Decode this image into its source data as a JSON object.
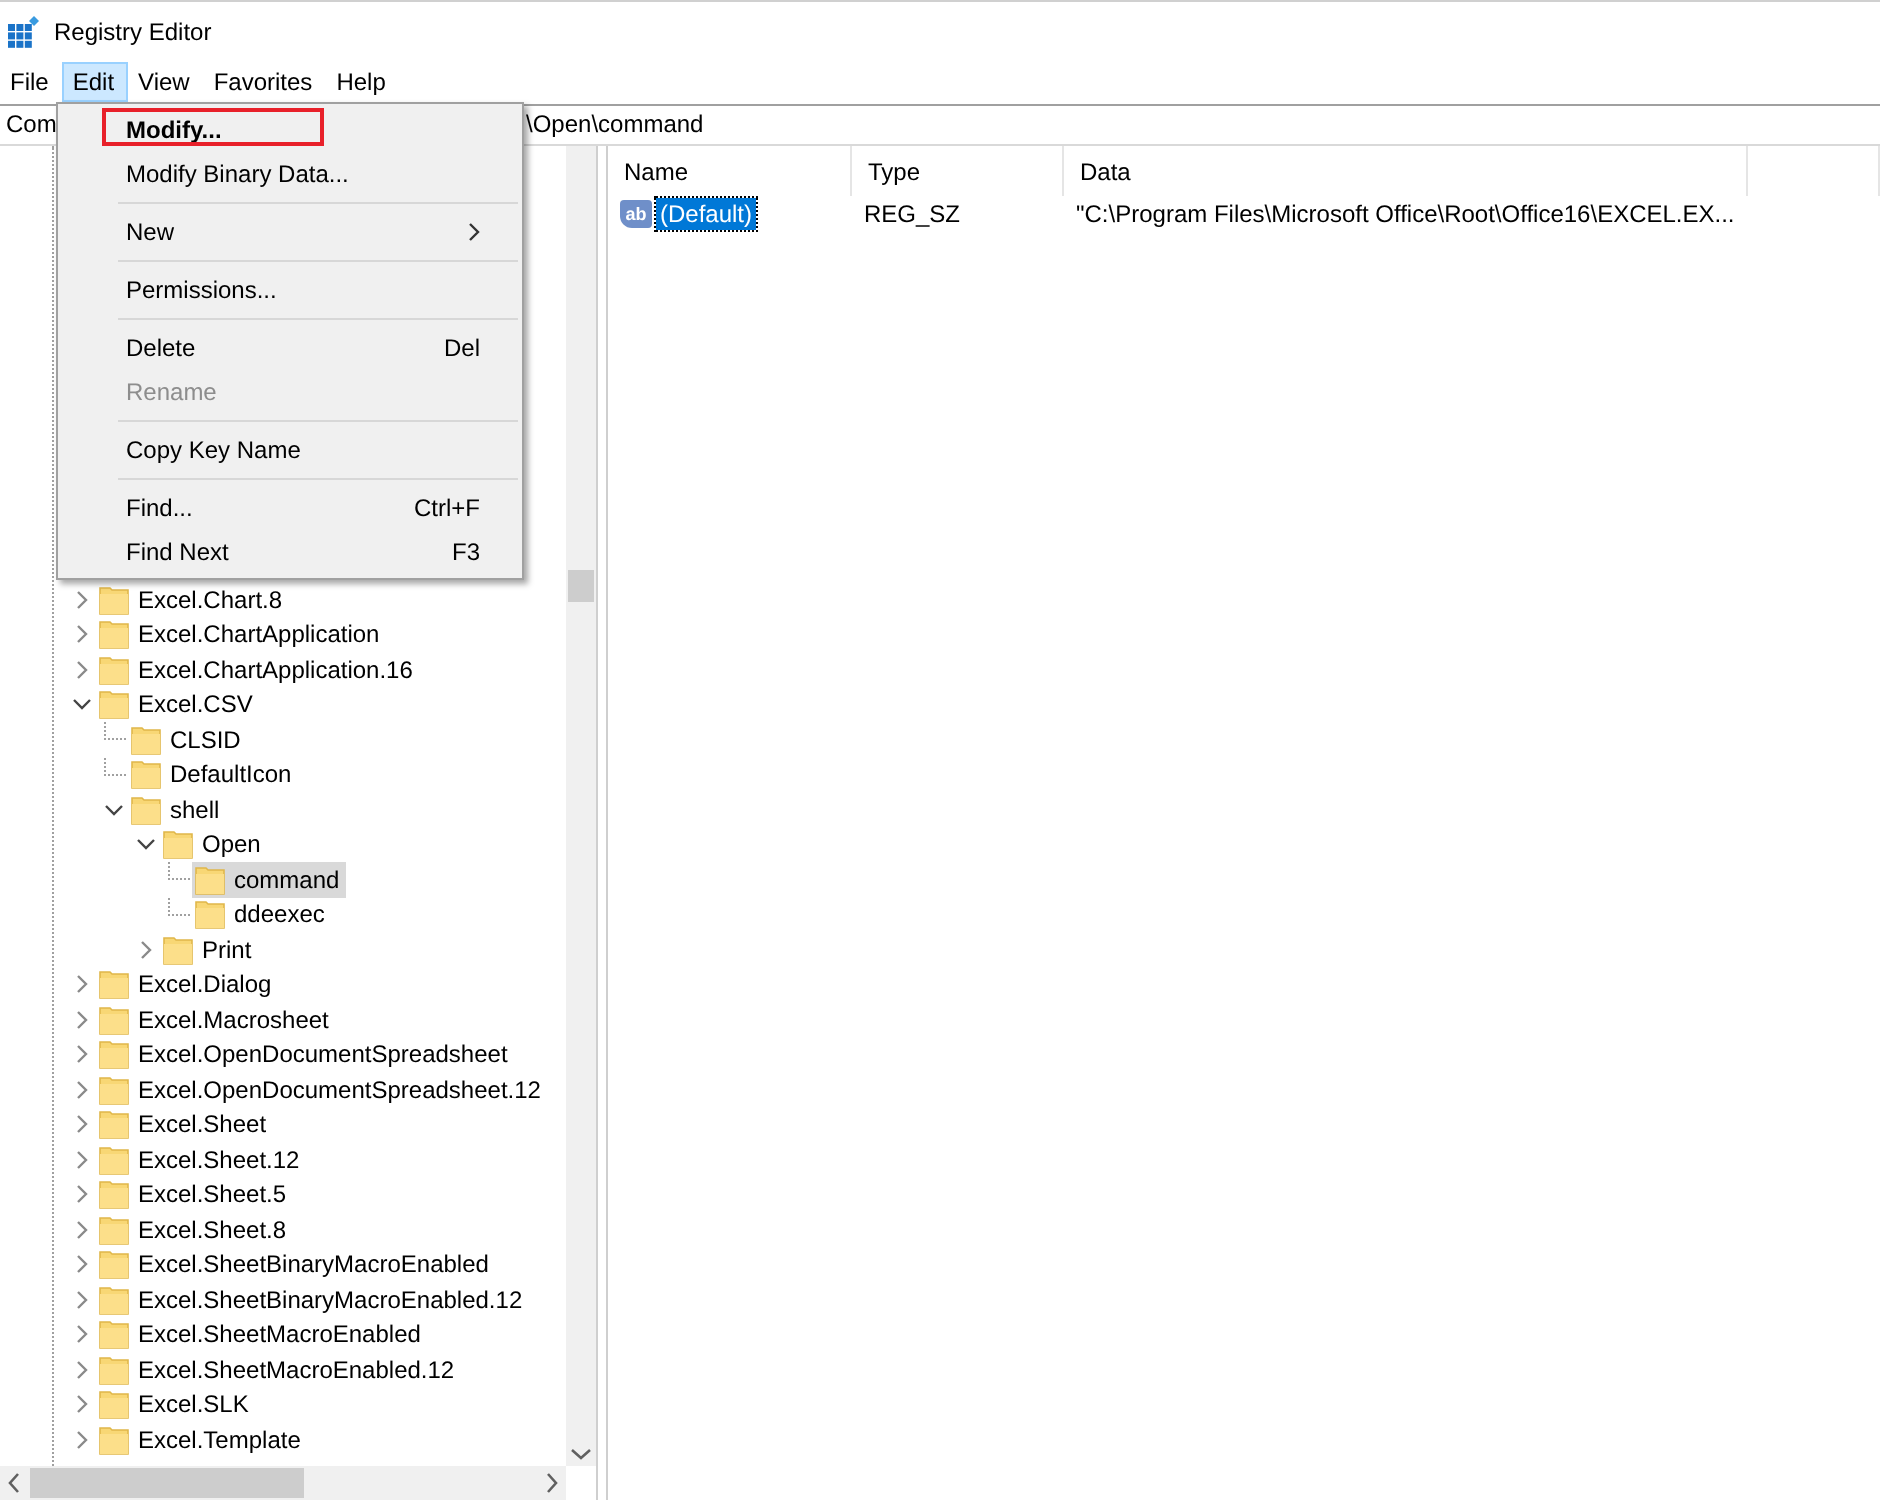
{
  "window": {
    "title": "Registry Editor"
  },
  "menu_bar": [
    {
      "label": "File",
      "selected": false
    },
    {
      "label": "Edit",
      "selected": true
    },
    {
      "label": "View",
      "selected": false
    },
    {
      "label": "Favorites",
      "selected": false
    },
    {
      "label": "Help",
      "selected": false
    }
  ],
  "address": {
    "visible_parts": [
      "Com",
      "\\Open\\command"
    ]
  },
  "edit_menu": [
    {
      "kind": "item",
      "label": "Modify...",
      "default": true,
      "highlighted": true,
      "disabled": false,
      "submenu": false
    },
    {
      "kind": "item",
      "label": "Modify Binary Data...",
      "default": false,
      "highlighted": false,
      "disabled": false,
      "submenu": false
    },
    {
      "kind": "separator"
    },
    {
      "kind": "item",
      "label": "New",
      "default": false,
      "highlighted": false,
      "disabled": false,
      "submenu": true
    },
    {
      "kind": "separator"
    },
    {
      "kind": "item",
      "label": "Permissions...",
      "default": false,
      "highlighted": false,
      "disabled": false,
      "submenu": false
    },
    {
      "kind": "separator"
    },
    {
      "kind": "item",
      "label": "Delete",
      "shortcut": "Del",
      "default": false,
      "highlighted": false,
      "disabled": false,
      "submenu": false
    },
    {
      "kind": "item",
      "label": "Rename",
      "default": false,
      "highlighted": false,
      "disabled": true,
      "submenu": false
    },
    {
      "kind": "separator"
    },
    {
      "kind": "item",
      "label": "Copy Key Name",
      "default": false,
      "highlighted": false,
      "disabled": false,
      "submenu": false
    },
    {
      "kind": "separator"
    },
    {
      "kind": "item",
      "label": "Find...",
      "shortcut": "Ctrl+F",
      "default": false,
      "highlighted": false,
      "disabled": false,
      "submenu": false
    },
    {
      "kind": "item",
      "label": "Find Next",
      "shortcut": "F3",
      "default": false,
      "highlighted": false,
      "disabled": false,
      "submenu": false
    }
  ],
  "tree": {
    "items": [
      {
        "label": "Excel.Chart.8",
        "expandable": true,
        "expanded": false,
        "selected": false
      },
      {
        "label": "Excel.ChartApplication",
        "expandable": true,
        "expanded": false,
        "selected": false
      },
      {
        "label": "Excel.ChartApplication.16",
        "expandable": true,
        "expanded": false,
        "selected": false
      },
      {
        "label": "Excel.CSV",
        "expandable": true,
        "expanded": true,
        "selected": false,
        "children": [
          {
            "label": "CLSID",
            "expandable": false,
            "selected": false
          },
          {
            "label": "DefaultIcon",
            "expandable": false,
            "selected": false
          },
          {
            "label": "shell",
            "expandable": true,
            "expanded": true,
            "selected": false,
            "children": [
              {
                "label": "Open",
                "expandable": true,
                "expanded": true,
                "selected": false,
                "children": [
                  {
                    "label": "command",
                    "expandable": false,
                    "selected": true
                  },
                  {
                    "label": "ddeexec",
                    "expandable": false,
                    "selected": false
                  }
                ]
              },
              {
                "label": "Print",
                "expandable": true,
                "expanded": false,
                "selected": false
              }
            ]
          }
        ]
      },
      {
        "label": "Excel.Dialog",
        "expandable": true,
        "expanded": false,
        "selected": false
      },
      {
        "label": "Excel.Macrosheet",
        "expandable": true,
        "expanded": false,
        "selected": false
      },
      {
        "label": "Excel.OpenDocumentSpreadsheet",
        "expandable": true,
        "expanded": false,
        "selected": false
      },
      {
        "label": "Excel.OpenDocumentSpreadsheet.12",
        "expandable": true,
        "expanded": false,
        "selected": false
      },
      {
        "label": "Excel.Sheet",
        "expandable": true,
        "expanded": false,
        "selected": false
      },
      {
        "label": "Excel.Sheet.12",
        "expandable": true,
        "expanded": false,
        "selected": false
      },
      {
        "label": "Excel.Sheet.5",
        "expandable": true,
        "expanded": false,
        "selected": false
      },
      {
        "label": "Excel.Sheet.8",
        "expandable": true,
        "expanded": false,
        "selected": false
      },
      {
        "label": "Excel.SheetBinaryMacroEnabled",
        "expandable": true,
        "expanded": false,
        "selected": false
      },
      {
        "label": "Excel.SheetBinaryMacroEnabled.12",
        "expandable": true,
        "expanded": false,
        "selected": false
      },
      {
        "label": "Excel.SheetMacroEnabled",
        "expandable": true,
        "expanded": false,
        "selected": false
      },
      {
        "label": "Excel.SheetMacroEnabled.12",
        "expandable": true,
        "expanded": false,
        "selected": false
      },
      {
        "label": "Excel.SLK",
        "expandable": true,
        "expanded": false,
        "selected": false
      },
      {
        "label": "Excel.Template",
        "expandable": true,
        "expanded": false,
        "selected": false
      }
    ]
  },
  "values": {
    "columns": [
      "Name",
      "Type",
      "Data"
    ],
    "rows": [
      {
        "icon_label": "ab",
        "name": "(Default)",
        "type": "REG_SZ",
        "data": "\"C:\\Program Files\\Microsoft Office\\Root\\Office16\\EXCEL.EX...",
        "selected": true
      }
    ]
  }
}
